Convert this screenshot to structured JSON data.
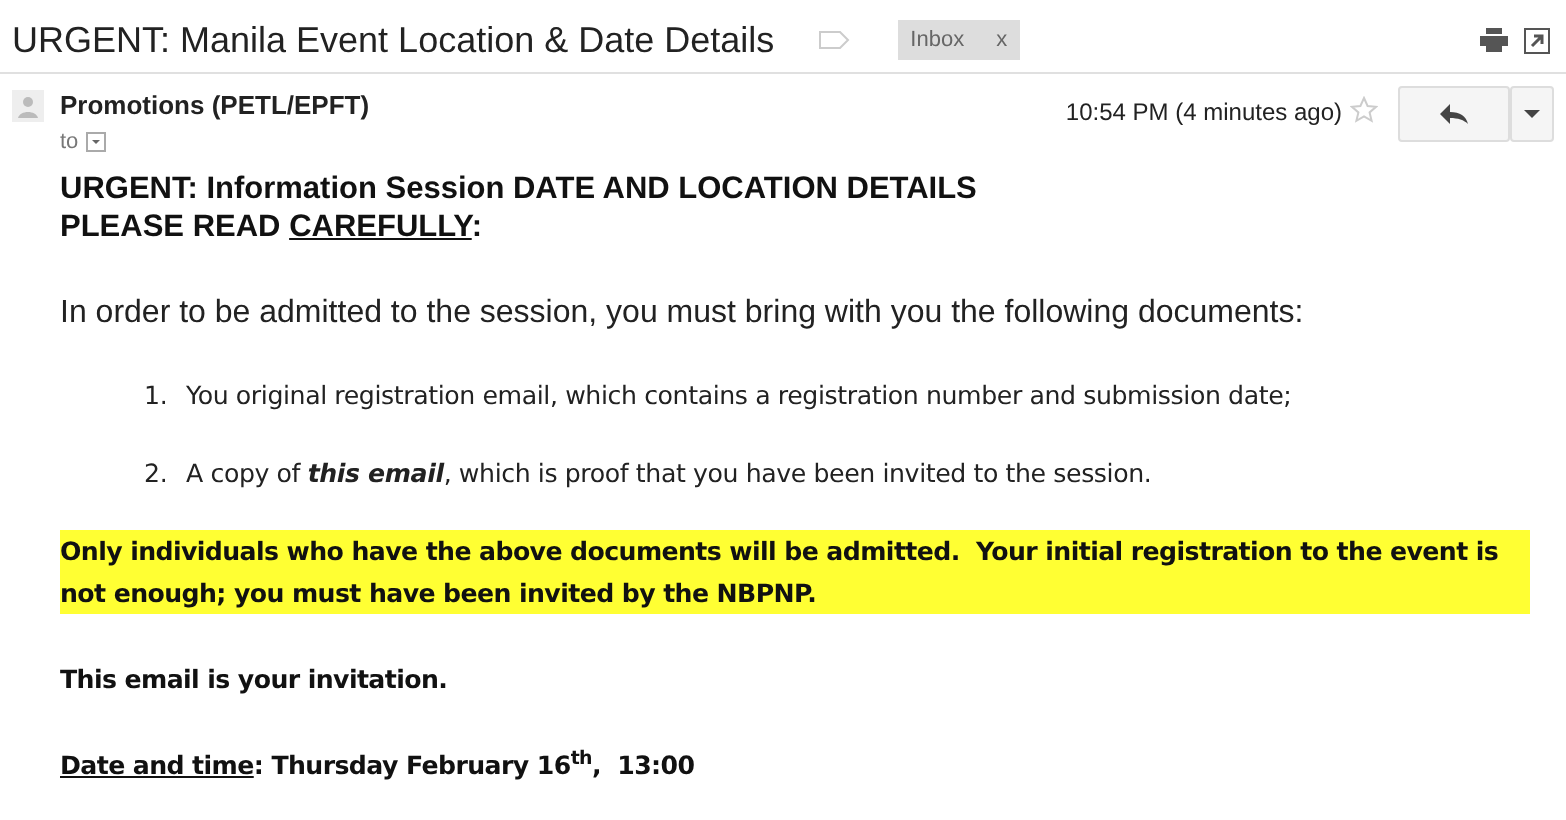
{
  "subject": "URGENT: Manila Event Location & Date Details",
  "label": {
    "text": "Inbox",
    "remove": "x"
  },
  "sender": {
    "name": "Promotions (PETL/EPFT)",
    "to": "to",
    "time": "10:54 PM (4 minutes ago)",
    "starred": false
  },
  "body": [
    {
      "kind": "heading",
      "lines": [
        [
          {
            "text": "URGENT: Information Session DATE AND LOCATION DETAILS",
            "underlined": false
          }
        ],
        [
          {
            "text": "PLEASE READ ",
            "underlined": false
          },
          {
            "text": "CAREFULLY",
            "underlined": true
          },
          {
            "text": ":",
            "underlined": false
          }
        ]
      ]
    },
    {
      "kind": "paragraph",
      "text": "In order to be admitted to the session, you must bring with you the following documents:"
    },
    {
      "kind": "list",
      "items": [
        {
          "number": "1.",
          "text": "You original registration email, which contains a registration number and submission date;"
        },
        {
          "number": "2.",
          "text": "A copy of **this email**, which is proof that you have been invited to the session."
        }
      ]
    },
    {
      "kind": "note",
      "highlighted": true,
      "segments": [
        {
          "text": "Only individuals who have the above documents will be admitted.  Your initial registration to the event is not enough; you must have been invited by the NBPNP.",
          "underlined": false
        }
      ]
    },
    {
      "kind": "note",
      "highlighted": false,
      "segments": [
        {
          "text": "This email is your invitation.",
          "underlined": false
        }
      ]
    },
    {
      "kind": "note",
      "highlighted": false,
      "segments": [
        {
          "text": "Date and time",
          "underlined": true
        },
        {
          "text": ": Thursday February 16$^{th}$,  13:00",
          "underlined": false
        }
      ]
    }
  ]
}
